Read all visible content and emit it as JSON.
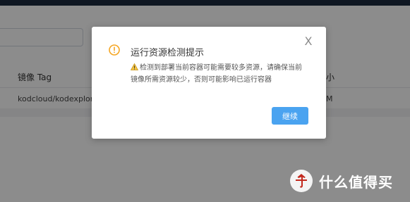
{
  "background": {
    "table": {
      "headers": {
        "image_tag": "镜像 Tag",
        "size": "小"
      },
      "row": {
        "image": "kodcloud/kodexplore",
        "size": "M"
      }
    }
  },
  "dialog": {
    "title": "运行资源检测提示",
    "message": "检测到部署当前容器可能需要较多资源，请确保当前镜像所需资源较少，否则可能影响已运行容器",
    "continue_label": "继续",
    "close_label": "X"
  },
  "watermark": {
    "text": "什么值得买"
  },
  "colors": {
    "accent": "#4aa3f0",
    "warning": "#f5a623"
  }
}
